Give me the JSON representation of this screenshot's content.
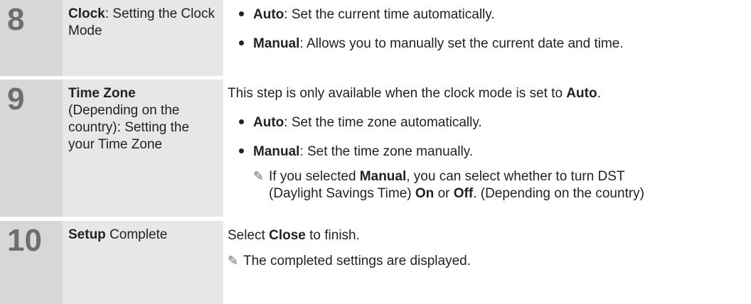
{
  "rows": [
    {
      "number": "8",
      "title_bold": "Clock",
      "title_rest": ": Setting the Clock Mode",
      "bullets": [
        {
          "bold": "Auto",
          "text": ": Set the current time automatically."
        },
        {
          "bold": "Manual",
          "text": ": Allows you to manually set the current date and time."
        }
      ]
    },
    {
      "number": "9",
      "title_bold": "Time Zone",
      "title_rest": "(Depending on the country): Setting the your Time Zone",
      "intro_text": "This step is only available when the clock mode is set to ",
      "intro_bold": "Auto",
      "intro_end": ".",
      "bullets": [
        {
          "bold": "Auto",
          "text": ": Set the time zone automatically."
        },
        {
          "bold": "Manual",
          "text": ": Set the time zone manually."
        }
      ],
      "note": {
        "icon": "pencil-note-icon",
        "pre": "If you selected ",
        "b1": "Manual",
        "mid": ", you can select whether to turn DST",
        "line2_pre": "(Daylight Savings Time) ",
        "b2": "On",
        "or": " or ",
        "b3": "Off",
        "end": ". (Depending on the country)"
      }
    },
    {
      "number": "10",
      "title_bold": "Setup",
      "title_rest": " Complete",
      "intro_text": "Select ",
      "intro_bold": "Close",
      "intro_end": " to finish.",
      "note": {
        "icon": "pencil-note-icon",
        "text": "The completed settings are displayed."
      }
    }
  ],
  "colors": {
    "number_bg": "#d7d7d7",
    "title_bg": "#e7e7e7",
    "number_text": "#6e6e6e"
  }
}
